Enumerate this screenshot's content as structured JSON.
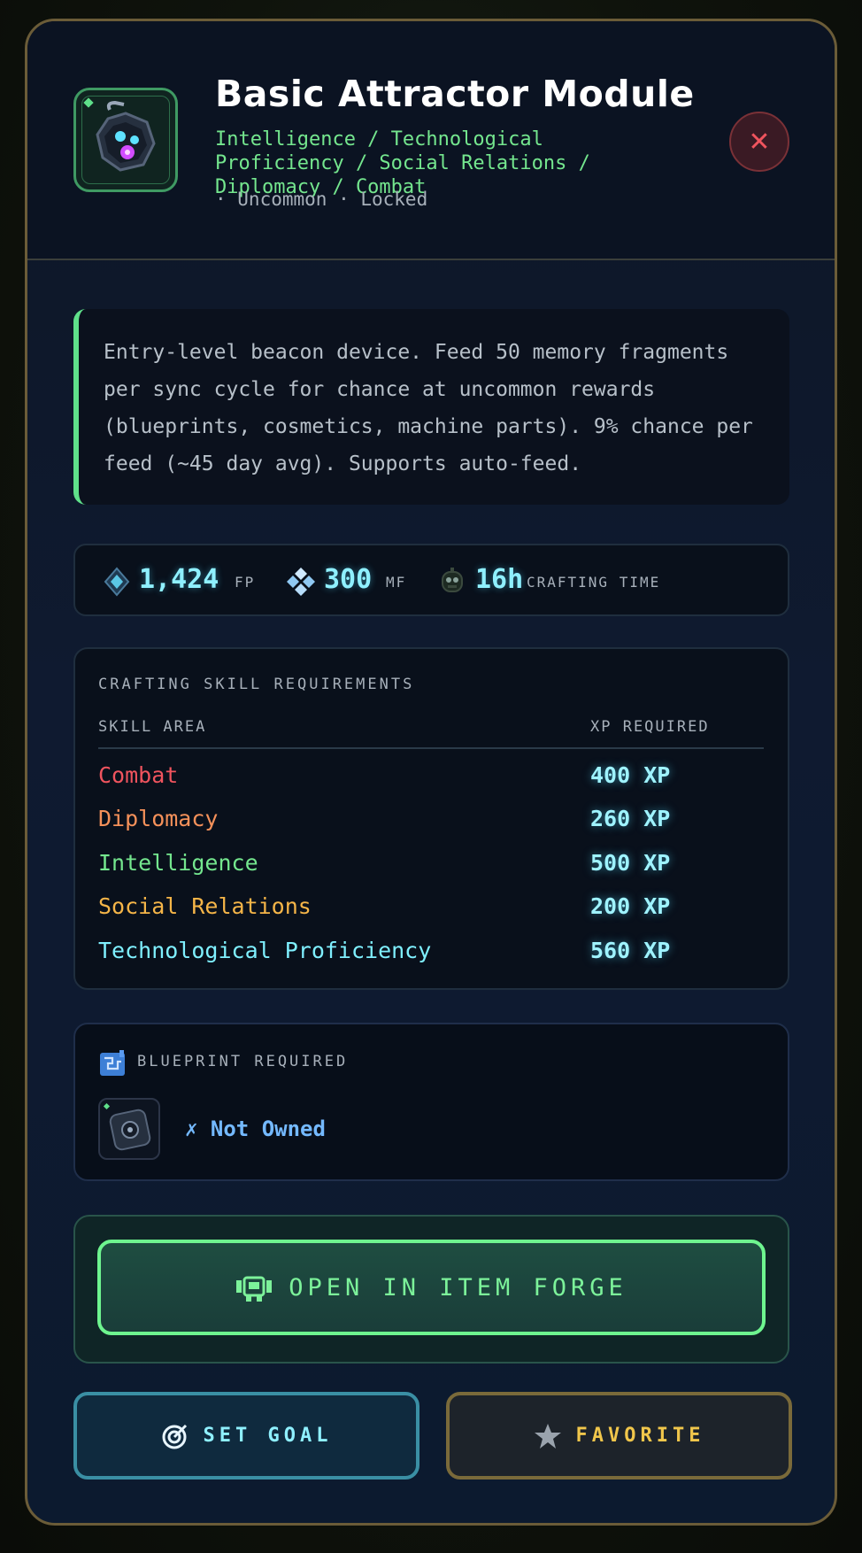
{
  "item": {
    "title": "Basic Attractor Module",
    "categories": "Intelligence / Technological Proficiency / Social Relations / Diplomacy / Combat",
    "meta": "· Uncommon · Locked",
    "icon": "attractor-module-icon",
    "rarity_color": "#5fe08a"
  },
  "close_label": "✕",
  "description": "Entry-level beacon device. Feed 50 memory fragments per sync cycle for chance at uncommon rewards (blueprints, cosmetics, machine parts). 9% chance per feed (~45 day avg). Supports auto-feed.",
  "stats": {
    "fp": {
      "value": "1,424",
      "unit": "FP",
      "icon": "fp-crystal-icon"
    },
    "mf": {
      "value": "300",
      "unit": "MF",
      "icon": "memory-fragment-icon"
    },
    "time": {
      "value": "16h",
      "unit": "CRAFTING TIME",
      "icon": "robot-timer-icon"
    }
  },
  "skills": {
    "section_title": "CRAFTING SKILL REQUIREMENTS",
    "col_area": "SKILL AREA",
    "col_xp": "XP REQUIRED",
    "rows": [
      {
        "name": "Combat",
        "xp": "400 XP",
        "color": "#f0545e"
      },
      {
        "name": "Diplomacy",
        "xp": "260 XP",
        "color": "#f5915a"
      },
      {
        "name": "Intelligence",
        "xp": "500 XP",
        "color": "#74e68e"
      },
      {
        "name": "Social Relations",
        "xp": "200 XP",
        "color": "#f5b548"
      },
      {
        "name": "Technological Proficiency",
        "xp": "560 XP",
        "color": "#7ff0ff"
      }
    ]
  },
  "blueprint": {
    "label": "BLUEPRINT REQUIRED",
    "status": "✗ Not Owned",
    "icon": "blueprint-icon"
  },
  "forge": {
    "label": "OPEN IN ITEM FORGE",
    "icon": "forge-icon"
  },
  "actions": {
    "goal": {
      "label": "SET GOAL",
      "icon": "target-icon"
    },
    "favorite": {
      "label": "FAVORITE",
      "icon": "star-icon"
    }
  }
}
